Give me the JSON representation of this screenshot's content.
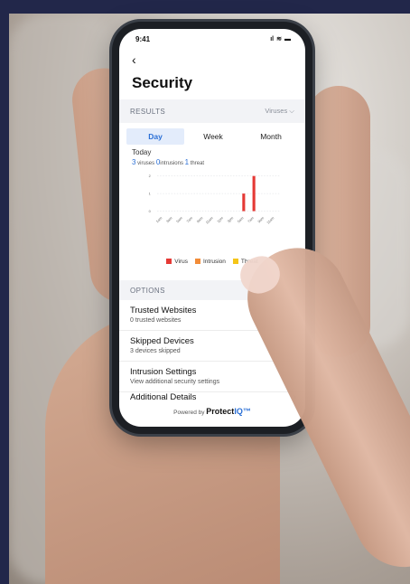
{
  "status_bar": {
    "time": "9:41",
    "signal": "ıl",
    "wifi": "≋",
    "battery": "▬"
  },
  "header": {
    "back_icon": "chevron-left",
    "title": "Security"
  },
  "results": {
    "label": "RESULTS",
    "filter": "Viruses ⌵",
    "tabs": [
      "Day",
      "Week",
      "Month"
    ],
    "active_tab": "Day",
    "period": "Today",
    "stats": [
      {
        "value": "3",
        "label": "viruses"
      },
      {
        "value": "0",
        "label": "intrusions"
      },
      {
        "value": "1",
        "label": "threat"
      }
    ]
  },
  "chart_data": {
    "type": "bar",
    "categories": [
      "1am",
      "3am",
      "5am",
      "7am",
      "9am",
      "11am",
      "1pm",
      "3pm",
      "5am",
      "7am",
      "9am",
      "11am"
    ],
    "series": [
      {
        "name": "Virus",
        "color": "#e53935",
        "values": [
          0,
          0,
          0,
          0,
          0,
          0,
          0,
          0,
          1,
          2,
          0,
          0
        ]
      },
      {
        "name": "Intrusion",
        "color": "#f28c38",
        "values": [
          0,
          0,
          0,
          0,
          0,
          0,
          0,
          0,
          0,
          0,
          0,
          0
        ]
      },
      {
        "name": "Threat",
        "color": "#f5c518",
        "values": [
          0,
          0,
          0,
          0,
          0,
          0,
          0,
          0,
          0,
          0,
          0,
          0
        ]
      }
    ],
    "yticks": [
      "0",
      "1",
      "2"
    ],
    "ylim": [
      0,
      2
    ]
  },
  "options": {
    "label": "OPTIONS",
    "items": [
      {
        "title": "Trusted Websites",
        "subtitle": "0 trusted websites"
      },
      {
        "title": "Skipped Devices",
        "subtitle": "3 devices skipped"
      },
      {
        "title": "Intrusion Settings",
        "subtitle": "View additional security settings"
      },
      {
        "title": "Additional Details",
        "subtitle": ""
      }
    ],
    "chevron": "›"
  },
  "footer": {
    "powered_by": "Powered by",
    "brand_prefix": "Protect",
    "brand_suffix": "IQ™"
  }
}
